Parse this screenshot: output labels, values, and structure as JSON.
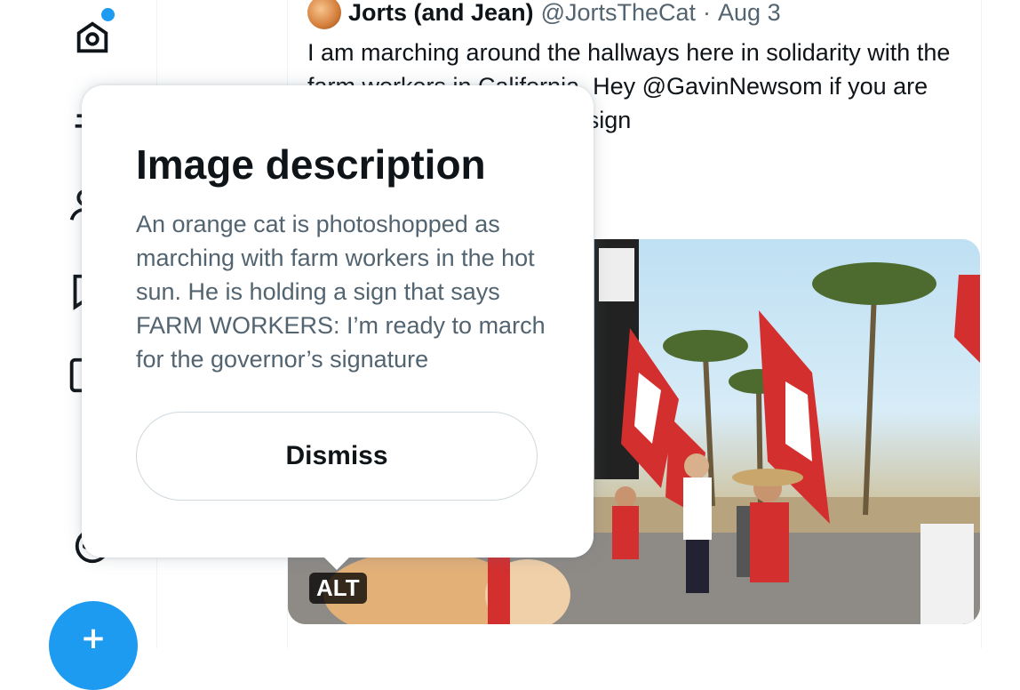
{
  "tweet": {
    "author_name": "Jorts (and Jean)",
    "handle": "@JortsTheCat",
    "separator": "·",
    "date": "Aug 3",
    "text": "I am marching around the hallways here in solidarity with the farm workers in California. Hey @GavinNewsom if you are actually a good guy, you’ll sign"
  },
  "media": {
    "alt_badge": "ALT"
  },
  "popover": {
    "title": "Image description",
    "description": "An orange cat is photoshopped as marching with farm workers in the hot sun. He is holding a sign that says FARM WORKERS: I’m ready to march for the governor’s signature",
    "dismiss_label": "Dismiss"
  },
  "nav": {
    "icons": [
      "home-icon",
      "explore-icon",
      "notifications-icon",
      "messages-icon",
      "bookmarks-icon",
      "lists-icon",
      "profile-icon",
      "more-icon"
    ],
    "compose_glyph": "+"
  },
  "colors": {
    "accent": "#1d9bf0",
    "text_primary": "#0f1419",
    "text_secondary": "#536471"
  }
}
